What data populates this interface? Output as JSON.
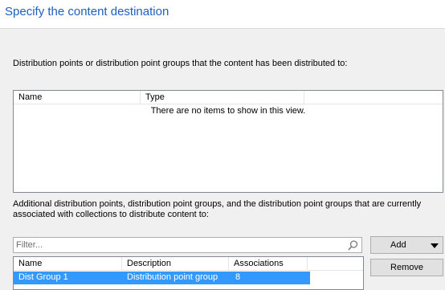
{
  "header": {
    "title": "Specify the content destination"
  },
  "distributed": {
    "label": "Distribution points or distribution point groups that the content has been distributed to:",
    "columns": [
      "Name",
      "Type"
    ],
    "empty_message": "There are no items to show in this view."
  },
  "additional": {
    "label_line1": "Additional distribution points, distribution point groups, and the distribution point groups that are currently",
    "label_line2": "associated with collections to distribute content to:",
    "filter_placeholder": "Filter...",
    "columns": [
      "Name",
      "Description",
      "Associations"
    ],
    "rows": [
      {
        "name": "Dist Group 1",
        "description": "Distribution point group",
        "associations": "8"
      }
    ]
  },
  "buttons": {
    "add": "Add",
    "remove": "Remove"
  },
  "colors": {
    "title": "#1f5fbf",
    "selection": "#3399ff"
  },
  "icons": {
    "search": "search-icon",
    "dropdown": "chevron-down-icon"
  }
}
